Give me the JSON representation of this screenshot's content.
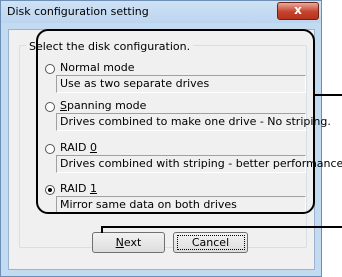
{
  "window": {
    "title": "Disk configuration setting",
    "close_glyph": "x"
  },
  "group": {
    "label": "Select the disk configuration."
  },
  "options": [
    {
      "label_pre": "Normal",
      "mnemonic": "",
      "label_post": " mode",
      "description": "Use as two separate drives",
      "selected": false
    },
    {
      "label_pre": "",
      "mnemonic": "S",
      "label_post": "panning mode",
      "description": "Drives combined to make one drive - No striping.",
      "selected": false
    },
    {
      "label_pre": "RAID ",
      "mnemonic": "0",
      "label_post": "",
      "description": "Drives combined with striping - better performance.",
      "selected": false
    },
    {
      "label_pre": "RAID ",
      "mnemonic": "1",
      "label_post": "",
      "description": "Mirror same data on both drives",
      "selected": true
    }
  ],
  "buttons": {
    "next_mnemonic": "N",
    "next_rest": "ext",
    "cancel": "Cancel"
  },
  "colors": {
    "window_frame": "#c3dbf1",
    "client_bg": "#f0f0f0",
    "close_button": "#c4432c"
  }
}
